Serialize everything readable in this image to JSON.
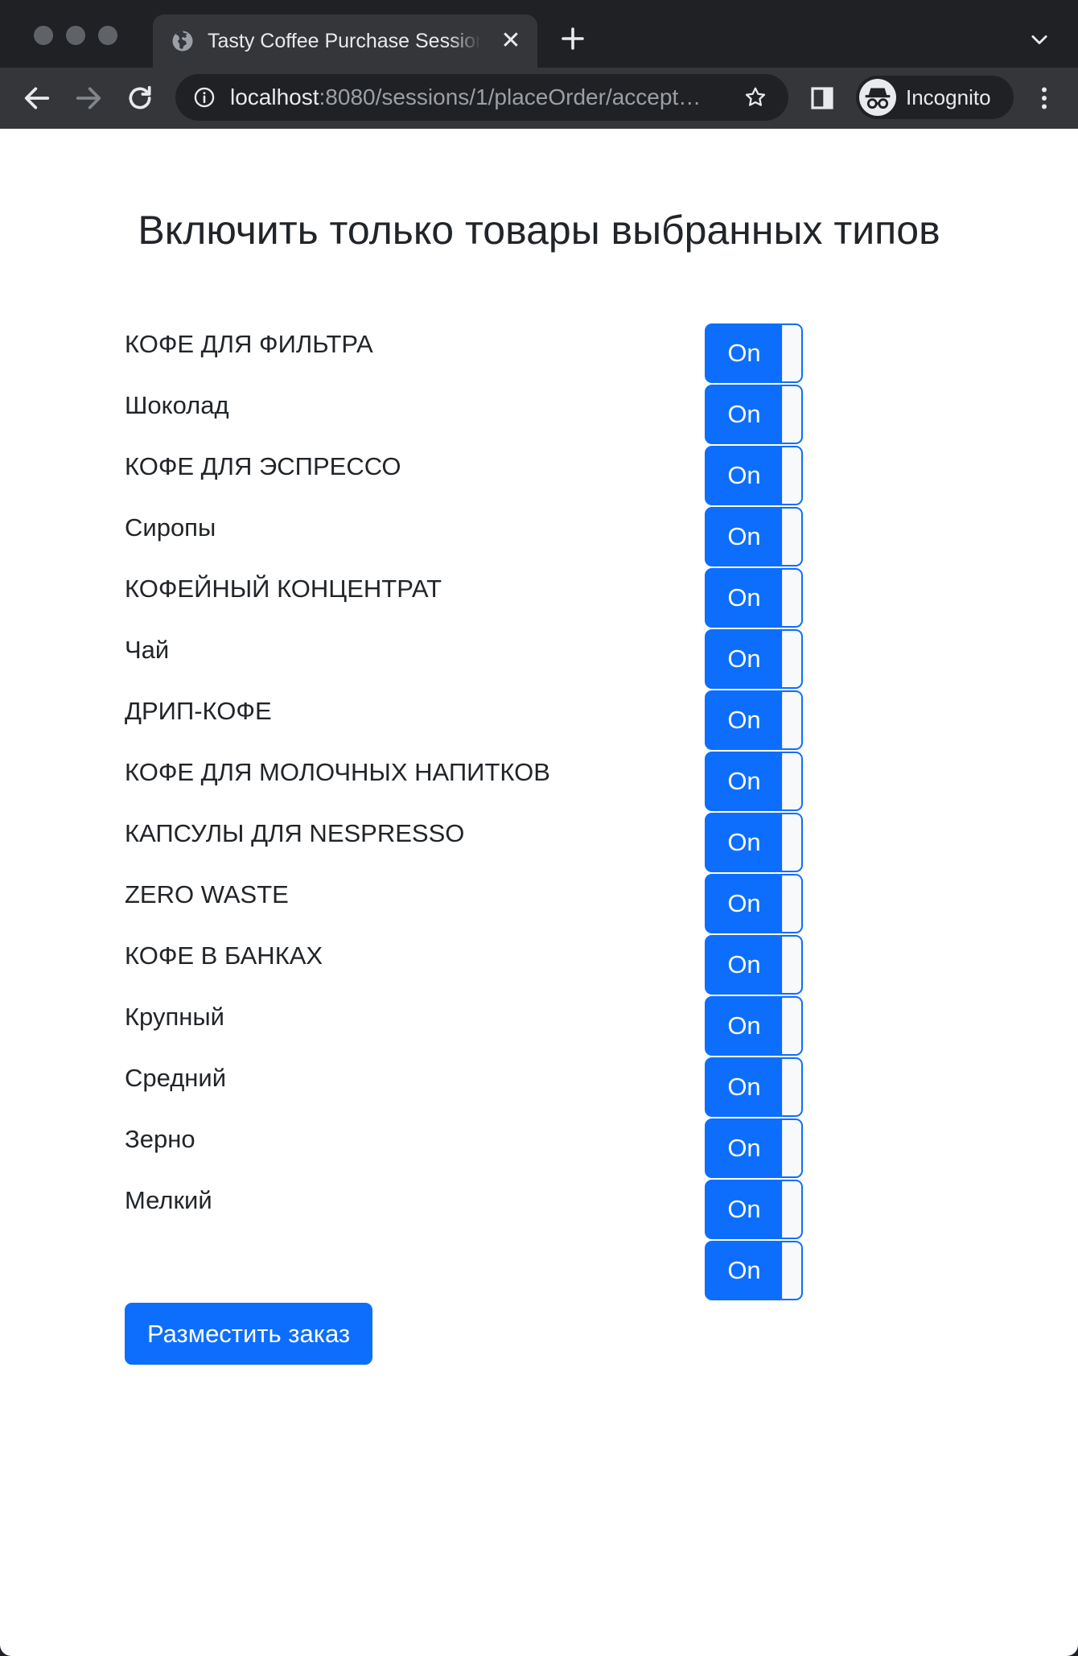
{
  "browser": {
    "tab": {
      "title": "Tasty Coffee Purchase Session",
      "close_glyph": "✕"
    },
    "new_tab_icon": "plus-icon",
    "address": {
      "host": "localhost",
      "rest": ":8080/sessions/1/placeOrder/accept…"
    },
    "profile_label": "Incognito"
  },
  "page": {
    "heading": "Включить только товары выбранных типов",
    "categories": [
      {
        "label": "КОФЕ ДЛЯ ФИЛЬТРА",
        "toggle": "On"
      },
      {
        "label": "Шоколад",
        "toggle": "On"
      },
      {
        "label": "КОФЕ ДЛЯ ЭСПРЕССО",
        "toggle": "On"
      },
      {
        "label": "Сиропы",
        "toggle": "On"
      },
      {
        "label": "КОФЕЙНЫЙ КОНЦЕНТРАТ",
        "toggle": "On"
      },
      {
        "label": "Чай",
        "toggle": "On"
      },
      {
        "label": "ДРИП-КОФЕ",
        "toggle": "On"
      },
      {
        "label": "КОФЕ ДЛЯ МОЛОЧНЫХ НАПИТКОВ",
        "toggle": "On"
      },
      {
        "label": "КАПСУЛЫ ДЛЯ NESPRESSO",
        "toggle": "On"
      },
      {
        "label": "ZERO WASTE",
        "toggle": "On"
      },
      {
        "label": "КОФЕ В БАНКАХ",
        "toggle": "On"
      },
      {
        "label": "Крупный",
        "toggle": "On"
      },
      {
        "label": "Средний",
        "toggle": "On"
      },
      {
        "label": "Зерно",
        "toggle": "On"
      },
      {
        "label": "Мелкий",
        "toggle": "On"
      },
      {
        "label": "",
        "toggle": "On"
      }
    ],
    "submit_label": "Разместить заказ"
  },
  "colors": {
    "accent": "#0d6efd",
    "text": "#212529",
    "chrome_dark": "#202124",
    "chrome_toolbar": "#35363a"
  }
}
